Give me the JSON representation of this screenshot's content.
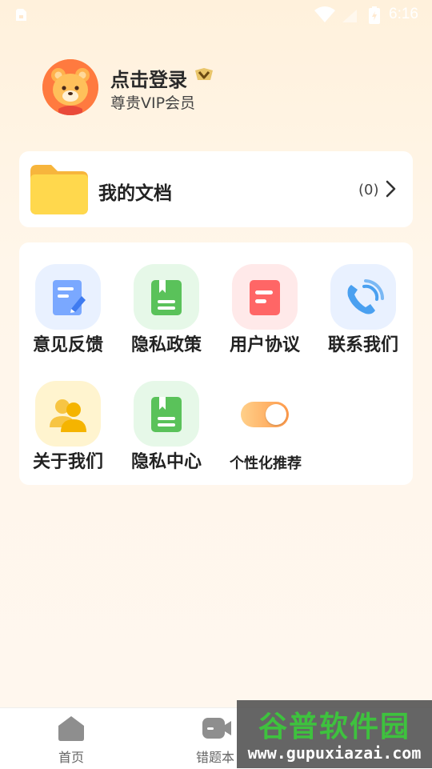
{
  "status_bar": {
    "time": "6:16"
  },
  "profile": {
    "login_label": "点击登录",
    "member_label": "尊贵VIP会员"
  },
  "documents": {
    "title": "我的文档",
    "count": "(0)"
  },
  "grid": {
    "items": [
      {
        "label": "意见反馈",
        "icon": "feedback-icon",
        "tile_color": "#e9f1ff"
      },
      {
        "label": "隐私政策",
        "icon": "privacy-policy-icon",
        "tile_color": "#e6f8e8"
      },
      {
        "label": "用户协议",
        "icon": "user-agreement-icon",
        "tile_color": "#ffe9e9"
      },
      {
        "label": "联系我们",
        "icon": "phone-icon",
        "tile_color": "#e9f1ff"
      },
      {
        "label": "关于我们",
        "icon": "about-us-icon",
        "tile_color": "#fff4cf"
      },
      {
        "label": "隐私中心",
        "icon": "privacy-center-icon",
        "tile_color": "#e6f8e8"
      }
    ],
    "toggle": {
      "label": "个性化推荐",
      "state": "on"
    }
  },
  "bottom_nav": {
    "items": [
      {
        "label": "首页",
        "icon": "home-icon"
      },
      {
        "label": "错题本",
        "icon": "camera-icon"
      }
    ]
  },
  "watermark": {
    "title": "谷普软件园",
    "url": "www.gupuxiazai.com"
  }
}
